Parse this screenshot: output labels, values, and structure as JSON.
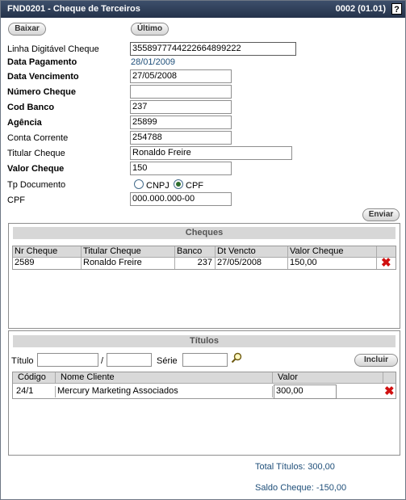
{
  "window": {
    "title": "FND0201 - Cheque de Terceiros",
    "code": "0002 (01.01)",
    "help": "?"
  },
  "toolbar": {
    "baixar": "Baixar",
    "ultimo": "Último"
  },
  "form": {
    "linha_label": "Linha Digitável Cheque",
    "linha_value": "3558977744222664899222",
    "data_pag_label": "Data Pagamento",
    "data_pag_value": "28/01/2009",
    "data_venc_label": "Data Vencimento",
    "data_venc_value": "27/05/2008",
    "numero_label": "Número Cheque",
    "numero_value": "",
    "banco_label": "Cod Banco",
    "banco_value": "237",
    "agencia_label": "Agência",
    "agencia_value": "25899",
    "conta_label": "Conta Corrente",
    "conta_value": "254788",
    "titular_label": "Titular Cheque",
    "titular_value": "Ronaldo Freire",
    "valor_label": "Valor Cheque",
    "valor_value": "150",
    "tpdoc_label": "Tp Documento",
    "tpdoc_cnpj": "CNPJ",
    "tpdoc_cpf": "CPF",
    "tpdoc_selected": "CPF",
    "cpf_label": "CPF",
    "cpf_value": "000.000.000-00",
    "enviar": "Enviar"
  },
  "cheques": {
    "title": "Cheques",
    "headers": [
      "Nr Cheque",
      "Titular Cheque",
      "Banco",
      "Dt Vencto",
      "Valor Cheque"
    ],
    "rows": [
      {
        "nr": "2589",
        "titular": "Ronaldo Freire",
        "banco": "237",
        "venc": "27/05/2008",
        "valor": "150,00"
      }
    ]
  },
  "titulos": {
    "title": "Títulos",
    "titulo_label": "Título",
    "sep": "/",
    "serie_label": "Série",
    "titulo_value": "",
    "titulo_value2": "",
    "serie_value": "",
    "incluir": "Incluir",
    "headers": [
      "Código",
      "Nome Cliente",
      "Valor"
    ],
    "rows": [
      {
        "codigo": "24/1",
        "nome": "Mercury Marketing Associados",
        "valor": "300,00"
      }
    ]
  },
  "totals": {
    "total_titulos": "Total Títulos:  300,00",
    "saldo_cheque": "Saldo Cheque:  -150,00"
  }
}
